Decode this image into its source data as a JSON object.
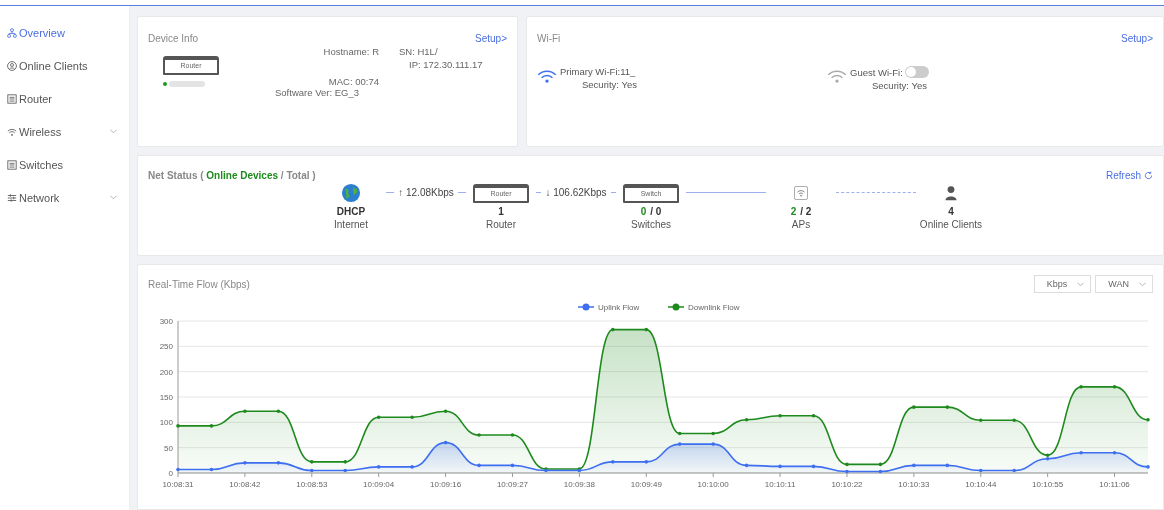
{
  "sidebar": {
    "items": [
      {
        "label": "Overview",
        "selected": true,
        "expandable": false
      },
      {
        "label": "Online Clients",
        "selected": false,
        "expandable": false
      },
      {
        "label": "Router",
        "selected": false,
        "expandable": false
      },
      {
        "label": "Wireless",
        "selected": false,
        "expandable": true
      },
      {
        "label": "Switches",
        "selected": false,
        "expandable": false
      },
      {
        "label": "Network",
        "selected": false,
        "expandable": true
      }
    ]
  },
  "device_info": {
    "title": "Device Info",
    "setup_link": "Setup>",
    "device_label": "Router",
    "online": true,
    "fields": [
      {
        "label": "Hostname:",
        "value": "R"
      },
      {
        "label": "SN:",
        "value": "H1L/"
      },
      {
        "label": "IP:",
        "value": "172.30.111.17"
      },
      {
        "label": "MAC:",
        "value": "00:74"
      },
      {
        "label": "Software Ver:",
        "value": "EG_3"
      }
    ]
  },
  "wifi": {
    "title": "Wi-Fi",
    "setup_link": "Setup>",
    "networks": [
      {
        "label": "Primary Wi-Fi:",
        "value": "11_",
        "security": "Security: Yes",
        "on": true,
        "kind": "plain"
      },
      {
        "label": "Guest Wi-Fi:",
        "security": "Security: Yes",
        "on": false,
        "kind": "switch"
      }
    ]
  },
  "net_status": {
    "title": "Net Status ( **Online Devices** / Total )",
    "refresh": "Refresh",
    "nodes": [
      {
        "kind": "internet",
        "value": "DHCP",
        "label": "Internet",
        "link_label": "↑ 12.08Kbps"
      },
      {
        "kind": "router",
        "device_label": "Router",
        "online": "1",
        "label": "Router",
        "link_label": "↓ 106.62Kbps"
      },
      {
        "kind": "switch",
        "device_label": "Switch",
        "online": "0",
        "total": "/ 0",
        "label": "Switches"
      },
      {
        "kind": "ap",
        "online": "2",
        "total": "/ 2",
        "label": "APs"
      },
      {
        "kind": "client",
        "online": "4",
        "label": "Online Clients"
      }
    ]
  },
  "flow": {
    "title": "Real-Time Flow (Kbps)",
    "selects": [
      "Kbps",
      "WAN"
    ],
    "chart_data": {
      "type": "area",
      "categories": [
        "10:08:31",
        null,
        "10:08:42",
        null,
        "10:08:53",
        null,
        "10:09:04",
        null,
        "10:09:16",
        null,
        "10:09:27",
        null,
        "10:09:38",
        null,
        "10:09:49",
        null,
        "10:10:00",
        null,
        "10:10:11",
        null,
        "10:10:22",
        null,
        "10:10:33",
        null,
        "10:10:44",
        null,
        "10:10:55",
        null,
        "10:11:06",
        null
      ],
      "series": [
        {
          "name": "Uplink Flow",
          "color": "#3d6ff0",
          "values": [
            7,
            7,
            20,
            20,
            5,
            5,
            12,
            12,
            60,
            15,
            15,
            5,
            5,
            22,
            22,
            57,
            57,
            15,
            13,
            13,
            3,
            3,
            15,
            15,
            5,
            5,
            28,
            40,
            40,
            12
          ]
        },
        {
          "name": "Downlink Flow",
          "color": "#1e8a1e",
          "values": [
            93,
            93,
            122,
            122,
            22,
            22,
            110,
            110,
            122,
            75,
            75,
            8,
            8,
            283,
            283,
            78,
            78,
            105,
            113,
            113,
            17,
            17,
            130,
            130,
            104,
            104,
            35,
            170,
            170,
            105
          ]
        }
      ],
      "grid": true,
      "legend": true,
      "ylim": [
        0,
        300
      ],
      "yticks": [
        0,
        50,
        100,
        150,
        200,
        250,
        300
      ]
    }
  }
}
